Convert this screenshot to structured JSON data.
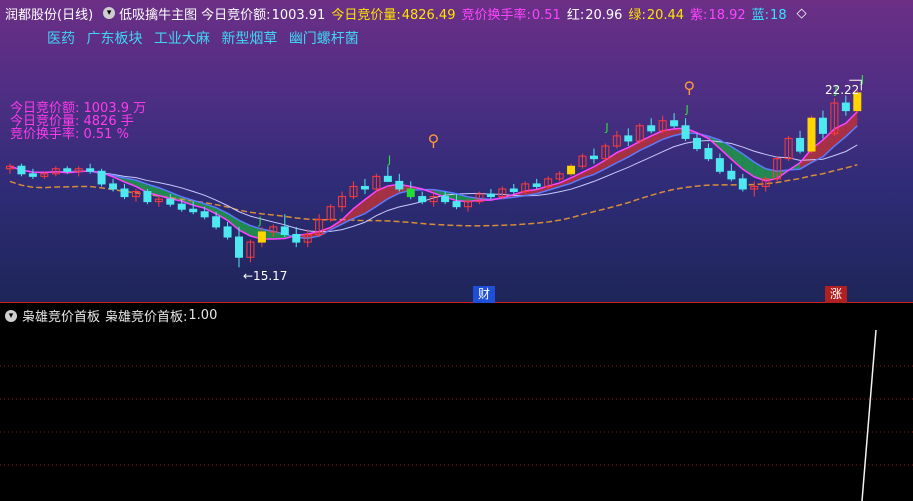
{
  "header": {
    "stock": "润都股份(日线)",
    "indicator": "低吸擒牛主图",
    "items": [
      {
        "label": "今日竞价额:",
        "value": "1003.91",
        "color": "#ffffff"
      },
      {
        "label": "今日竞价量:",
        "value": "4826.49",
        "color": "#ffe400"
      },
      {
        "label": "竞价换手率:",
        "value": "0.51",
        "color": "#ff44ff"
      },
      {
        "label": "红:",
        "value": "20.96",
        "color": "#ffffff"
      },
      {
        "label": "绿:",
        "value": "20.44",
        "color": "#ffe400"
      },
      {
        "label": "紫:",
        "value": "18.92",
        "color": "#ff44ff"
      },
      {
        "label": "蓝:",
        "value": "18",
        "color": "#35e6ff"
      }
    ],
    "arrow": "◇"
  },
  "sectors": [
    "医药",
    "广东板块",
    "工业大麻",
    "新型烟草",
    "幽门螺杆菌"
  ],
  "annotations": [
    "今日竞价额:  1003.9  万",
    "今日竞价量:  4826  手",
    "竞价换手率:  0.51  %"
  ],
  "price_labels": {
    "high": "22.22",
    "low": "15.17"
  },
  "markers": {
    "j": "J",
    "person": "⚲"
  },
  "badges": [
    {
      "text": "财",
      "color": "#ffffff",
      "bg": "#1f4fd6"
    },
    {
      "text": "涨",
      "color": "#ffffff",
      "bg": "#b02020"
    }
  ],
  "sub": {
    "title": "枭雄竞价首板",
    "series_label": "枭雄竞价首板:",
    "series_value": "1.00"
  },
  "chart_data": {
    "type": "candlestick",
    "candles": [
      [
        19.1,
        19.3,
        18.9,
        19.2
      ],
      [
        19.2,
        19.3,
        18.8,
        18.9
      ],
      [
        18.9,
        19.1,
        18.7,
        18.8
      ],
      [
        18.8,
        19.0,
        18.7,
        18.9
      ],
      [
        18.9,
        19.2,
        18.8,
        19.1
      ],
      [
        19.1,
        19.2,
        18.9,
        19.0
      ],
      [
        19.0,
        19.2,
        18.8,
        19.1
      ],
      [
        19.1,
        19.3,
        18.9,
        19.0
      ],
      [
        19.0,
        19.1,
        18.4,
        18.5
      ],
      [
        18.5,
        18.7,
        18.2,
        18.3
      ],
      [
        18.3,
        18.5,
        17.9,
        18.0
      ],
      [
        18.0,
        18.3,
        17.8,
        18.2
      ],
      [
        18.2,
        18.3,
        17.7,
        17.8
      ],
      [
        17.8,
        18.0,
        17.6,
        17.9
      ],
      [
        17.9,
        18.1,
        17.6,
        17.7
      ],
      [
        17.7,
        17.9,
        17.4,
        17.5
      ],
      [
        17.5,
        17.8,
        17.3,
        17.4
      ],
      [
        17.4,
        17.6,
        17.1,
        17.2
      ],
      [
        17.2,
        17.4,
        16.7,
        16.8
      ],
      [
        16.8,
        17.0,
        16.3,
        16.4
      ],
      [
        16.4,
        16.8,
        15.2,
        15.6
      ],
      [
        15.6,
        16.3,
        15.4,
        16.2
      ],
      [
        16.2,
        16.8,
        16.0,
        16.6
      ],
      [
        16.6,
        16.9,
        16.4,
        16.8
      ],
      [
        16.8,
        17.3,
        16.4,
        16.5
      ],
      [
        16.5,
        16.8,
        16.0,
        16.2
      ],
      [
        16.2,
        16.7,
        16.0,
        16.5
      ],
      [
        16.5,
        17.3,
        16.4,
        17.1
      ],
      [
        17.1,
        17.7,
        17.0,
        17.6
      ],
      [
        17.6,
        18.2,
        17.4,
        18.0
      ],
      [
        18.0,
        18.6,
        17.9,
        18.4
      ],
      [
        18.4,
        18.7,
        18.1,
        18.3
      ],
      [
        18.3,
        18.9,
        18.2,
        18.8
      ],
      [
        18.8,
        19.2,
        18.6,
        18.6
      ],
      [
        18.6,
        18.9,
        18.2,
        18.3
      ],
      [
        18.3,
        18.6,
        17.9,
        18.0
      ],
      [
        18.0,
        18.2,
        17.7,
        17.8
      ],
      [
        17.8,
        18.1,
        17.6,
        18.0
      ],
      [
        18.0,
        18.2,
        17.7,
        17.8
      ],
      [
        17.8,
        18.1,
        17.5,
        17.6
      ],
      [
        17.6,
        17.9,
        17.4,
        17.8
      ],
      [
        17.8,
        18.2,
        17.7,
        18.1
      ],
      [
        18.1,
        18.3,
        17.9,
        18.0
      ],
      [
        18.0,
        18.4,
        17.9,
        18.3
      ],
      [
        18.3,
        18.5,
        18.1,
        18.2
      ],
      [
        18.2,
        18.6,
        18.1,
        18.5
      ],
      [
        18.5,
        18.7,
        18.3,
        18.4
      ],
      [
        18.4,
        18.8,
        18.3,
        18.7
      ],
      [
        18.7,
        19.0,
        18.6,
        18.9
      ],
      [
        18.9,
        19.3,
        18.8,
        19.2
      ],
      [
        19.2,
        19.7,
        19.1,
        19.6
      ],
      [
        19.6,
        19.9,
        19.3,
        19.5
      ],
      [
        19.5,
        20.1,
        19.4,
        20.0
      ],
      [
        20.0,
        20.6,
        19.9,
        20.4
      ],
      [
        20.4,
        20.7,
        20.0,
        20.2
      ],
      [
        20.2,
        20.9,
        20.1,
        20.8
      ],
      [
        20.8,
        21.1,
        20.5,
        20.6
      ],
      [
        20.6,
        21.2,
        20.5,
        21.0
      ],
      [
        21.0,
        21.3,
        20.7,
        20.8
      ],
      [
        20.8,
        21.1,
        20.2,
        20.3
      ],
      [
        20.3,
        20.5,
        19.8,
        19.9
      ],
      [
        19.9,
        20.1,
        19.4,
        19.5
      ],
      [
        19.5,
        19.7,
        18.9,
        19.0
      ],
      [
        19.0,
        19.3,
        18.6,
        18.7
      ],
      [
        18.7,
        18.9,
        18.2,
        18.3
      ],
      [
        18.3,
        18.6,
        18.0,
        18.4
      ],
      [
        18.4,
        18.8,
        18.2,
        18.7
      ],
      [
        18.7,
        19.6,
        18.6,
        19.5
      ],
      [
        19.5,
        20.4,
        19.4,
        20.3
      ],
      [
        20.3,
        20.6,
        19.7,
        19.8
      ],
      [
        19.8,
        21.2,
        19.7,
        21.1
      ],
      [
        21.1,
        21.4,
        20.3,
        20.5
      ],
      [
        20.5,
        21.9,
        20.4,
        21.7
      ],
      [
        21.7,
        22.0,
        21.2,
        21.4
      ],
      [
        21.4,
        22.22,
        21.3,
        22.1
      ]
    ],
    "low_label": 15.17,
    "high_label": 22.22,
    "ma_lines": [
      {
        "color": "#ff44ff",
        "width": 1.5
      },
      {
        "color": "#5a7bff",
        "width": 1.5
      },
      {
        "color": "#c8c8ff",
        "width": 1
      }
    ],
    "sub_series": {
      "type": "line",
      "values_end": 1.0
    }
  }
}
